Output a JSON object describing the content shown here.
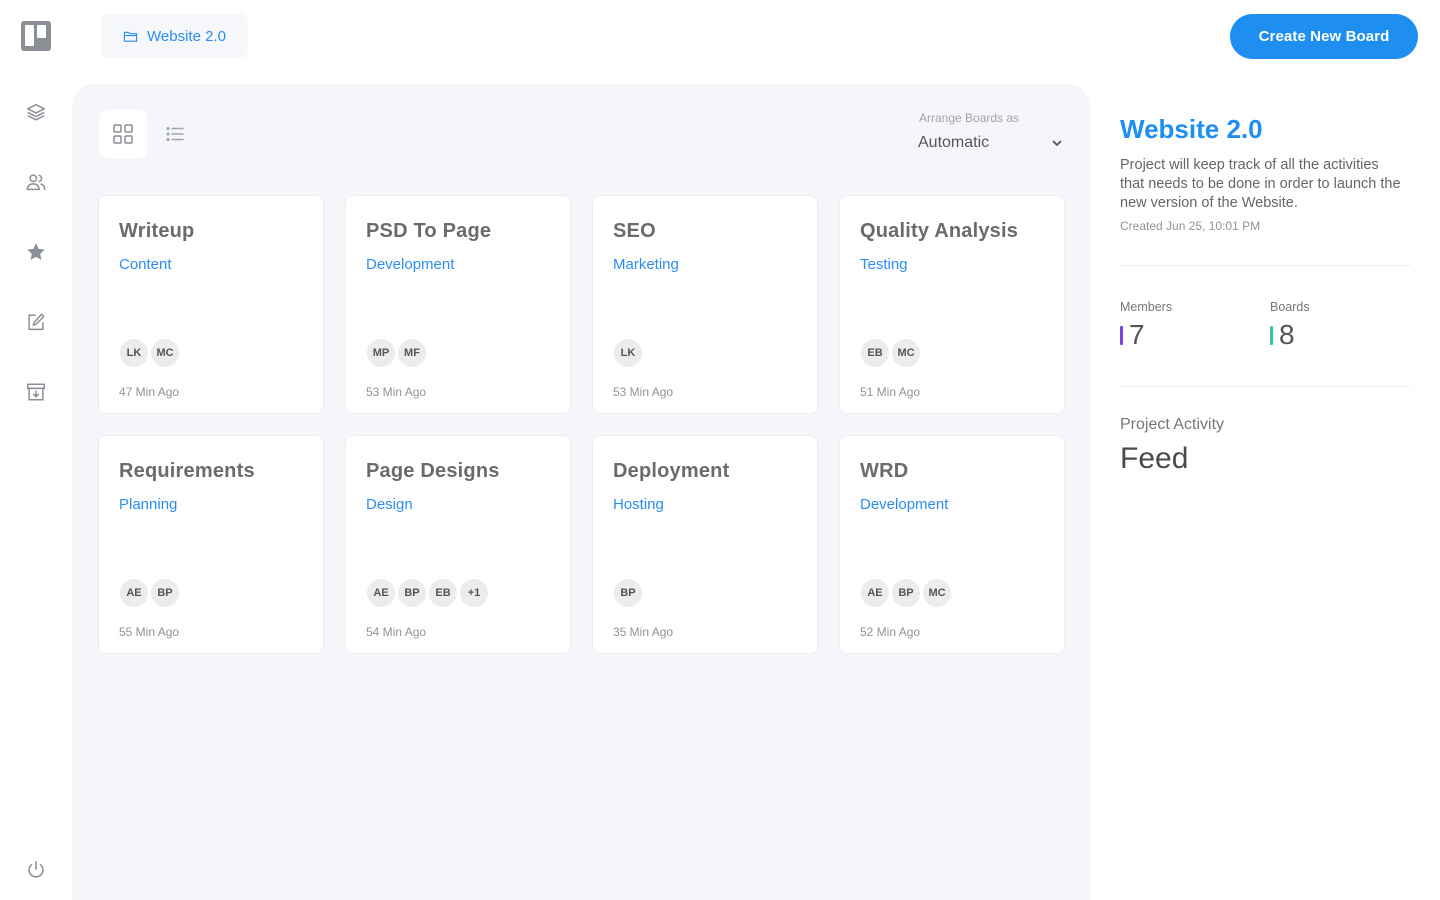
{
  "breadcrumb": {
    "label": "Website 2.0",
    "icon": "folder-icon"
  },
  "header": {
    "create_button": "Create New Board"
  },
  "sidebar": {
    "icons": [
      "logo-icon",
      "layers-icon",
      "users-icon",
      "star-icon",
      "edit-icon",
      "archive-icon",
      "power-icon"
    ]
  },
  "toolbar": {
    "arrange_label": "Arrange Boards as",
    "arrange_value": "Automatic"
  },
  "boards": [
    {
      "title": "Writeup",
      "category": "Content",
      "members": [
        "LK",
        "MC"
      ],
      "time": "47 Min Ago"
    },
    {
      "title": "PSD To Page",
      "category": "Development",
      "members": [
        "MP",
        "MF"
      ],
      "time": "53 Min Ago"
    },
    {
      "title": "SEO",
      "category": "Marketing",
      "members": [
        "LK"
      ],
      "time": "53 Min Ago"
    },
    {
      "title": "Quality Analysis",
      "category": "Testing",
      "members": [
        "EB",
        "MC"
      ],
      "time": "51 Min Ago"
    },
    {
      "title": "Requirements",
      "category": "Planning",
      "members": [
        "AE",
        "BP"
      ],
      "time": "55 Min Ago"
    },
    {
      "title": "Page Designs",
      "category": "Design",
      "members": [
        "AE",
        "BP",
        "EB",
        "+1"
      ],
      "time": "54 Min Ago"
    },
    {
      "title": "Deployment",
      "category": "Hosting",
      "members": [
        "BP"
      ],
      "time": "35 Min Ago"
    },
    {
      "title": "WRD",
      "category": "Development",
      "members": [
        "AE",
        "BP",
        "MC"
      ],
      "time": "52 Min Ago"
    }
  ],
  "project": {
    "title": "Website 2.0",
    "description": "Project will keep track of all the activities that needs to be done in order to launch the new version of the Website.",
    "created": "Created Jun 25, 10:01 PM",
    "members_label": "Members",
    "members_count": "7",
    "boards_label": "Boards",
    "boards_count": "8",
    "activity_label": "Project Activity",
    "activity_title": "Feed"
  },
  "colors": {
    "accent": "#1f8ef1",
    "members_bar": "#7b3fe4",
    "boards_bar": "#2ecc9a"
  }
}
